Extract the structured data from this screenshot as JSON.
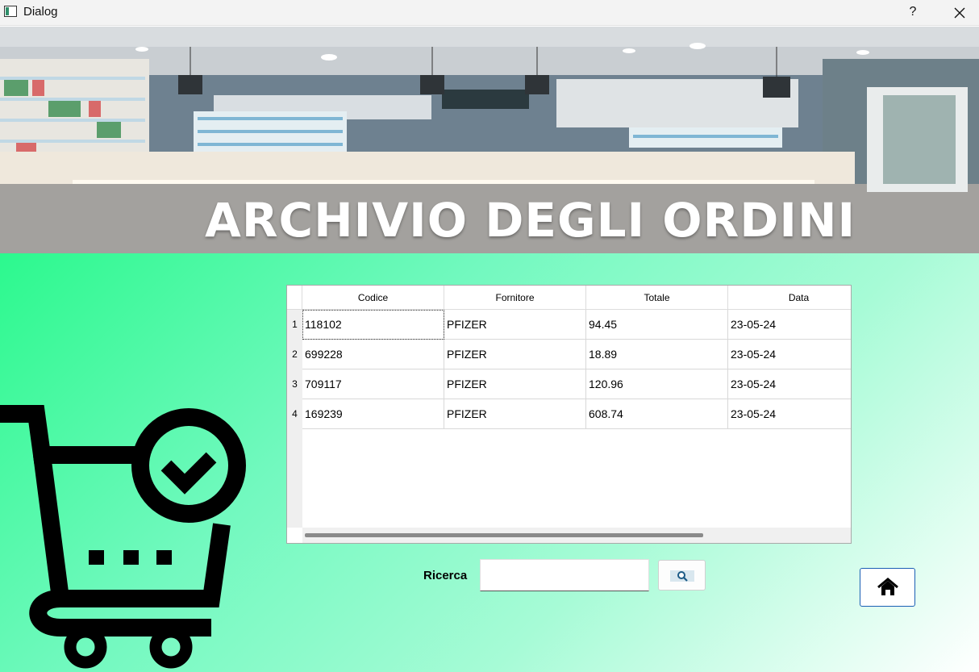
{
  "window": {
    "title": "Dialog",
    "help_label": "?",
    "close_label": "✕"
  },
  "banner": {
    "title": "ARCHIVIO DEGLI ORDINI"
  },
  "table": {
    "columns": [
      "Codice",
      "Fornitore",
      "Totale",
      "Data"
    ],
    "rows": [
      {
        "num": "1",
        "codice": "118102",
        "fornitore": "PFIZER",
        "totale": "94.45",
        "data": "23-05-24"
      },
      {
        "num": "2",
        "codice": "699228",
        "fornitore": "PFIZER",
        "totale": "18.89",
        "data": "23-05-24"
      },
      {
        "num": "3",
        "codice": "709117",
        "fornitore": "PFIZER",
        "totale": "120.96",
        "data": "23-05-24"
      },
      {
        "num": "4",
        "codice": "169239",
        "fornitore": "PFIZER",
        "totale": "608.74",
        "data": "23-05-24"
      }
    ]
  },
  "search": {
    "label": "Ricerca",
    "value": "",
    "button_icon": "magnifier-icon"
  },
  "home": {
    "icon": "home-icon"
  },
  "decor": {
    "cart_icon": "shopping-cart-check-icon"
  },
  "colors": {
    "accent_green": "#2cf98e",
    "home_border": "#1a5fb4"
  }
}
